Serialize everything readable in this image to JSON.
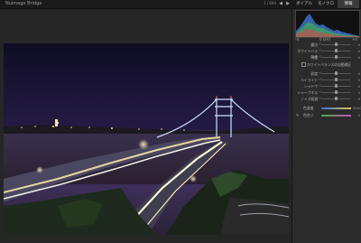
{
  "app": {
    "title": "Nuimage Bridge",
    "file_info": "1 / 684"
  },
  "nav": {
    "prev": "◀",
    "next": "▶"
  },
  "tabs": [
    {
      "label": "ダイアル補正",
      "active": false
    },
    {
      "label": "モノクロム",
      "active": false
    },
    {
      "label": "情報",
      "active": true
    }
  ],
  "histogram": {
    "left_label": "-4",
    "mid_label": "0 (EV)",
    "right_label": "+4"
  },
  "controls_top": [
    {
      "label": "露出",
      "value": "0",
      "knob": 0.5
    },
    {
      "label": "ホワイトバランス",
      "value": "0",
      "knob": 0.5
    },
    {
      "label": "明度",
      "value": "0",
      "knob": 0.5
    }
  ],
  "checkbox": {
    "label": "ホワイトバランスの自動補正"
  },
  "controls_bottom": [
    {
      "label": "彩度",
      "value": "0",
      "knob": 0.5
    },
    {
      "label": "ハイライト",
      "value": "0",
      "knob": 0.5
    },
    {
      "label": "シャドウ",
      "value": "0",
      "knob": 0.5
    },
    {
      "label": "シャープネス",
      "value": "0",
      "knob": 0.5
    },
    {
      "label": "ノイズ低減",
      "value": "0",
      "knob": 0.5
    }
  ],
  "color_rows": [
    {
      "label": "色温度",
      "value": "5500",
      "colors": [
        "#3b6fd1",
        "#e0c34c"
      ]
    },
    {
      "label": "色合い",
      "value": "0",
      "colors": [
        "#3fae4b",
        "#c64fb7"
      ]
    }
  ],
  "colors": {
    "accent": "#3b6fd1",
    "panel": "#2b2b2b",
    "background": "#262626"
  }
}
